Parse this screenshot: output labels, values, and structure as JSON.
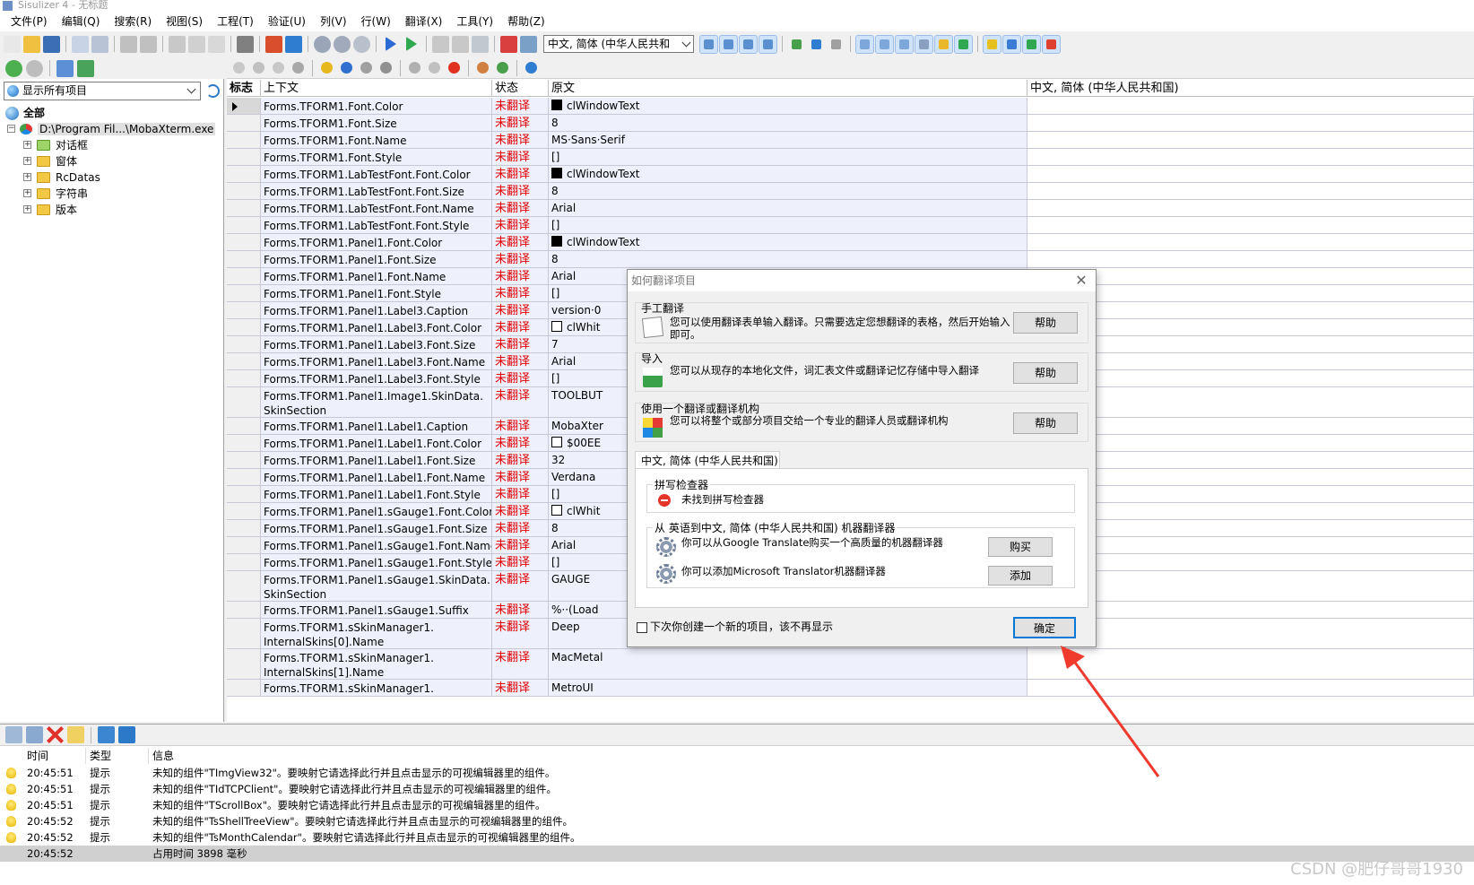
{
  "window": {
    "title": "Sisulizer 4 - 无标题"
  },
  "menu": [
    "文件(P)",
    "编辑(Q)",
    "搜索(R)",
    "视图(S)",
    "工程(T)",
    "验证(U)",
    "列(V)",
    "行(W)",
    "翻译(X)",
    "工具(Y)",
    "帮助(Z)"
  ],
  "toolbar": {
    "language_select": "中文, 简体 (中华人民共和"
  },
  "left_panel": {
    "filter": "显示所有项目",
    "tree": {
      "root": "全部",
      "project": "D:\\Program Fil...\\MobaXterm.exe",
      "children": [
        "对话框",
        "窗体",
        "RcDatas",
        "字符串",
        "版本"
      ]
    }
  },
  "grid": {
    "columns": {
      "flag": "标志",
      "context": "上下文",
      "status": "状态",
      "original": "原文",
      "target": "中文, 简体 (中华人民共和国)"
    },
    "rows": [
      {
        "context": "Forms.TFORM1.Font.Color",
        "status": "未翻译",
        "original": "clWindowText",
        "swatch": "#000000"
      },
      {
        "context": "Forms.TFORM1.Font.Size",
        "status": "未翻译",
        "original": "8"
      },
      {
        "context": "Forms.TFORM1.Font.Name",
        "status": "未翻译",
        "original": "MS·Sans·Serif"
      },
      {
        "context": "Forms.TFORM1.Font.Style",
        "status": "未翻译",
        "original": "[]"
      },
      {
        "context": "Forms.TFORM1.LabTestFont.Font.Color",
        "status": "未翻译",
        "original": "clWindowText",
        "swatch": "#000000"
      },
      {
        "context": "Forms.TFORM1.LabTestFont.Font.Size",
        "status": "未翻译",
        "original": "8"
      },
      {
        "context": "Forms.TFORM1.LabTestFont.Font.Name",
        "status": "未翻译",
        "original": "Arial"
      },
      {
        "context": "Forms.TFORM1.LabTestFont.Font.Style",
        "status": "未翻译",
        "original": "[]"
      },
      {
        "context": "Forms.TFORM1.Panel1.Font.Color",
        "status": "未翻译",
        "original": "clWindowText",
        "swatch": "#000000"
      },
      {
        "context": "Forms.TFORM1.Panel1.Font.Size",
        "status": "未翻译",
        "original": "8"
      },
      {
        "context": "Forms.TFORM1.Panel1.Font.Name",
        "status": "未翻译",
        "original": "Arial"
      },
      {
        "context": "Forms.TFORM1.Panel1.Font.Style",
        "status": "未翻译",
        "original": "[]"
      },
      {
        "context": "Forms.TFORM1.Panel1.Label3.Caption",
        "status": "未翻译",
        "original": "version·0"
      },
      {
        "context": "Forms.TFORM1.Panel1.Label3.Font.Color",
        "status": "未翻译",
        "original": "clWhit",
        "swatch": "#ffffff"
      },
      {
        "context": "Forms.TFORM1.Panel1.Label3.Font.Size",
        "status": "未翻译",
        "original": "7"
      },
      {
        "context": "Forms.TFORM1.Panel1.Label3.Font.Name",
        "status": "未翻译",
        "original": "Arial"
      },
      {
        "context": "Forms.TFORM1.Panel1.Label3.Font.Style",
        "status": "未翻译",
        "original": "[]"
      },
      {
        "context": "Forms.TFORM1.Panel1.Image1.SkinData. SkinSection",
        "status": "未翻译",
        "original": "TOOLBUT"
      },
      {
        "context": "Forms.TFORM1.Panel1.Label1.Caption",
        "status": "未翻译",
        "original": "MobaXter"
      },
      {
        "context": "Forms.TFORM1.Panel1.Label1.Font.Color",
        "status": "未翻译",
        "original": "$00EE",
        "swatch": "#ffffff"
      },
      {
        "context": "Forms.TFORM1.Panel1.Label1.Font.Size",
        "status": "未翻译",
        "original": "32"
      },
      {
        "context": "Forms.TFORM1.Panel1.Label1.Font.Name",
        "status": "未翻译",
        "original": "Verdana"
      },
      {
        "context": "Forms.TFORM1.Panel1.Label1.Font.Style",
        "status": "未翻译",
        "original": "[]"
      },
      {
        "context": "Forms.TFORM1.Panel1.sGauge1.Font.Color",
        "status": "未翻译",
        "original": "clWhit",
        "swatch": "#ffffff"
      },
      {
        "context": "Forms.TFORM1.Panel1.sGauge1.Font.Size",
        "status": "未翻译",
        "original": "8"
      },
      {
        "context": "Forms.TFORM1.Panel1.sGauge1.Font.Name",
        "status": "未翻译",
        "original": "Arial"
      },
      {
        "context": "Forms.TFORM1.Panel1.sGauge1.Font.Style",
        "status": "未翻译",
        "original": "[]"
      },
      {
        "context": "Forms.TFORM1.Panel1.sGauge1.SkinData. SkinSection",
        "status": "未翻译",
        "original": "GAUGE"
      },
      {
        "context": "Forms.TFORM1.Panel1.sGauge1.Suffix",
        "status": "未翻译",
        "original": "%··(Load"
      },
      {
        "context": "Forms.TFORM1.sSkinManager1. InternalSkins[0].Name",
        "status": "未翻译",
        "original": "Deep"
      },
      {
        "context": "Forms.TFORM1.sSkinManager1. InternalSkins[1].Name",
        "status": "未翻译",
        "original": "MacMetal"
      },
      {
        "context": "Forms.TFORM1.sSkinManager1.",
        "status": "未翻译",
        "original": "MetroUI"
      }
    ]
  },
  "log": {
    "columns": {
      "time": "时间",
      "type": "类型",
      "info": "信息"
    },
    "rows": [
      {
        "time": "20:45:51",
        "type": "提示",
        "info": "未知的组件\"TImgView32\"。要映射它请选择此行并且点击显示的可视编辑器里的组件。"
      },
      {
        "time": "20:45:51",
        "type": "提示",
        "info": "未知的组件\"TIdTCPClient\"。要映射它请选择此行并且点击显示的可视编辑器里的组件。"
      },
      {
        "time": "20:45:51",
        "type": "提示",
        "info": "未知的组件\"TScrollBox\"。要映射它请选择此行并且点击显示的可视编辑器里的组件。"
      },
      {
        "time": "20:45:52",
        "type": "提示",
        "info": "未知的组件\"TsShellTreeView\"。要映射它请选择此行并且点击显示的可视编辑器里的组件。"
      },
      {
        "time": "20:45:52",
        "type": "提示",
        "info": "未知的组件\"TsMonthCalendar\"。要映射它请选择此行并且点击显示的可视编辑器里的组件。"
      }
    ],
    "summary": {
      "time": "20:45:52",
      "info": "占用时间 3898 毫秒"
    }
  },
  "dialog": {
    "title": "如何翻译项目",
    "manual": {
      "title": "手工翻译",
      "desc": "您可以使用翻译表单输入翻译。只需要选定您想翻译的表格，然后开始输入即可。",
      "button": "帮助"
    },
    "import": {
      "title": "导入",
      "desc": "您可以从现存的本地化文件，词汇表文件或翻译记忆存储中导入翻译",
      "button": "帮助"
    },
    "agency": {
      "title": "使用一个翻译或翻译机构",
      "desc": "您可以将整个或部分项目交给一个专业的翻译人员或翻译机构",
      "button": "帮助"
    },
    "tab": "中文, 简体 (中华人民共和国)",
    "spell": {
      "title": "拼写检查器",
      "msg": "未找到拼写检查器"
    },
    "mt": {
      "title": "从 英语到中文, 简体 (中华人民共和国) 机器翻译器",
      "google": "你可以从Google Translate购买一个高质量的机器翻译器",
      "buy": "购买",
      "microsoft": "你可以添加Microsoft Translator机器翻译器",
      "add": "添加"
    },
    "dont_show": "下次你创建一个新的项目，该不再显示",
    "ok": "确定"
  },
  "watermark": "CSDN @肥仔哥哥1930",
  "colors": {
    "status_red": "#e00000",
    "row_tint": "#eef0fb",
    "annotation_arrow": "#f03a2e"
  }
}
